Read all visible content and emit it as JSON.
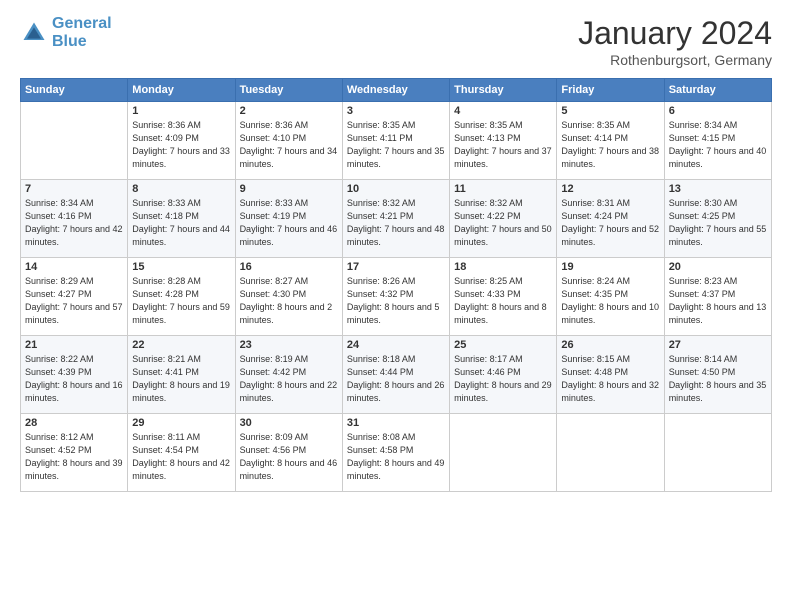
{
  "logo": {
    "line1": "General",
    "line2": "Blue"
  },
  "header": {
    "title": "January 2024",
    "subtitle": "Rothenburgsort, Germany"
  },
  "weekdays": [
    "Sunday",
    "Monday",
    "Tuesday",
    "Wednesday",
    "Thursday",
    "Friday",
    "Saturday"
  ],
  "weeks": [
    [
      {
        "day": "",
        "sunrise": "",
        "sunset": "",
        "daylight": ""
      },
      {
        "day": "1",
        "sunrise": "Sunrise: 8:36 AM",
        "sunset": "Sunset: 4:09 PM",
        "daylight": "Daylight: 7 hours and 33 minutes."
      },
      {
        "day": "2",
        "sunrise": "Sunrise: 8:36 AM",
        "sunset": "Sunset: 4:10 PM",
        "daylight": "Daylight: 7 hours and 34 minutes."
      },
      {
        "day": "3",
        "sunrise": "Sunrise: 8:35 AM",
        "sunset": "Sunset: 4:11 PM",
        "daylight": "Daylight: 7 hours and 35 minutes."
      },
      {
        "day": "4",
        "sunrise": "Sunrise: 8:35 AM",
        "sunset": "Sunset: 4:13 PM",
        "daylight": "Daylight: 7 hours and 37 minutes."
      },
      {
        "day": "5",
        "sunrise": "Sunrise: 8:35 AM",
        "sunset": "Sunset: 4:14 PM",
        "daylight": "Daylight: 7 hours and 38 minutes."
      },
      {
        "day": "6",
        "sunrise": "Sunrise: 8:34 AM",
        "sunset": "Sunset: 4:15 PM",
        "daylight": "Daylight: 7 hours and 40 minutes."
      }
    ],
    [
      {
        "day": "7",
        "sunrise": "Sunrise: 8:34 AM",
        "sunset": "Sunset: 4:16 PM",
        "daylight": "Daylight: 7 hours and 42 minutes."
      },
      {
        "day": "8",
        "sunrise": "Sunrise: 8:33 AM",
        "sunset": "Sunset: 4:18 PM",
        "daylight": "Daylight: 7 hours and 44 minutes."
      },
      {
        "day": "9",
        "sunrise": "Sunrise: 8:33 AM",
        "sunset": "Sunset: 4:19 PM",
        "daylight": "Daylight: 7 hours and 46 minutes."
      },
      {
        "day": "10",
        "sunrise": "Sunrise: 8:32 AM",
        "sunset": "Sunset: 4:21 PM",
        "daylight": "Daylight: 7 hours and 48 minutes."
      },
      {
        "day": "11",
        "sunrise": "Sunrise: 8:32 AM",
        "sunset": "Sunset: 4:22 PM",
        "daylight": "Daylight: 7 hours and 50 minutes."
      },
      {
        "day": "12",
        "sunrise": "Sunrise: 8:31 AM",
        "sunset": "Sunset: 4:24 PM",
        "daylight": "Daylight: 7 hours and 52 minutes."
      },
      {
        "day": "13",
        "sunrise": "Sunrise: 8:30 AM",
        "sunset": "Sunset: 4:25 PM",
        "daylight": "Daylight: 7 hours and 55 minutes."
      }
    ],
    [
      {
        "day": "14",
        "sunrise": "Sunrise: 8:29 AM",
        "sunset": "Sunset: 4:27 PM",
        "daylight": "Daylight: 7 hours and 57 minutes."
      },
      {
        "day": "15",
        "sunrise": "Sunrise: 8:28 AM",
        "sunset": "Sunset: 4:28 PM",
        "daylight": "Daylight: 7 hours and 59 minutes."
      },
      {
        "day": "16",
        "sunrise": "Sunrise: 8:27 AM",
        "sunset": "Sunset: 4:30 PM",
        "daylight": "Daylight: 8 hours and 2 minutes."
      },
      {
        "day": "17",
        "sunrise": "Sunrise: 8:26 AM",
        "sunset": "Sunset: 4:32 PM",
        "daylight": "Daylight: 8 hours and 5 minutes."
      },
      {
        "day": "18",
        "sunrise": "Sunrise: 8:25 AM",
        "sunset": "Sunset: 4:33 PM",
        "daylight": "Daylight: 8 hours and 8 minutes."
      },
      {
        "day": "19",
        "sunrise": "Sunrise: 8:24 AM",
        "sunset": "Sunset: 4:35 PM",
        "daylight": "Daylight: 8 hours and 10 minutes."
      },
      {
        "day": "20",
        "sunrise": "Sunrise: 8:23 AM",
        "sunset": "Sunset: 4:37 PM",
        "daylight": "Daylight: 8 hours and 13 minutes."
      }
    ],
    [
      {
        "day": "21",
        "sunrise": "Sunrise: 8:22 AM",
        "sunset": "Sunset: 4:39 PM",
        "daylight": "Daylight: 8 hours and 16 minutes."
      },
      {
        "day": "22",
        "sunrise": "Sunrise: 8:21 AM",
        "sunset": "Sunset: 4:41 PM",
        "daylight": "Daylight: 8 hours and 19 minutes."
      },
      {
        "day": "23",
        "sunrise": "Sunrise: 8:19 AM",
        "sunset": "Sunset: 4:42 PM",
        "daylight": "Daylight: 8 hours and 22 minutes."
      },
      {
        "day": "24",
        "sunrise": "Sunrise: 8:18 AM",
        "sunset": "Sunset: 4:44 PM",
        "daylight": "Daylight: 8 hours and 26 minutes."
      },
      {
        "day": "25",
        "sunrise": "Sunrise: 8:17 AM",
        "sunset": "Sunset: 4:46 PM",
        "daylight": "Daylight: 8 hours and 29 minutes."
      },
      {
        "day": "26",
        "sunrise": "Sunrise: 8:15 AM",
        "sunset": "Sunset: 4:48 PM",
        "daylight": "Daylight: 8 hours and 32 minutes."
      },
      {
        "day": "27",
        "sunrise": "Sunrise: 8:14 AM",
        "sunset": "Sunset: 4:50 PM",
        "daylight": "Daylight: 8 hours and 35 minutes."
      }
    ],
    [
      {
        "day": "28",
        "sunrise": "Sunrise: 8:12 AM",
        "sunset": "Sunset: 4:52 PM",
        "daylight": "Daylight: 8 hours and 39 minutes."
      },
      {
        "day": "29",
        "sunrise": "Sunrise: 8:11 AM",
        "sunset": "Sunset: 4:54 PM",
        "daylight": "Daylight: 8 hours and 42 minutes."
      },
      {
        "day": "30",
        "sunrise": "Sunrise: 8:09 AM",
        "sunset": "Sunset: 4:56 PM",
        "daylight": "Daylight: 8 hours and 46 minutes."
      },
      {
        "day": "31",
        "sunrise": "Sunrise: 8:08 AM",
        "sunset": "Sunset: 4:58 PM",
        "daylight": "Daylight: 8 hours and 49 minutes."
      },
      {
        "day": "",
        "sunrise": "",
        "sunset": "",
        "daylight": ""
      },
      {
        "day": "",
        "sunrise": "",
        "sunset": "",
        "daylight": ""
      },
      {
        "day": "",
        "sunrise": "",
        "sunset": "",
        "daylight": ""
      }
    ]
  ]
}
